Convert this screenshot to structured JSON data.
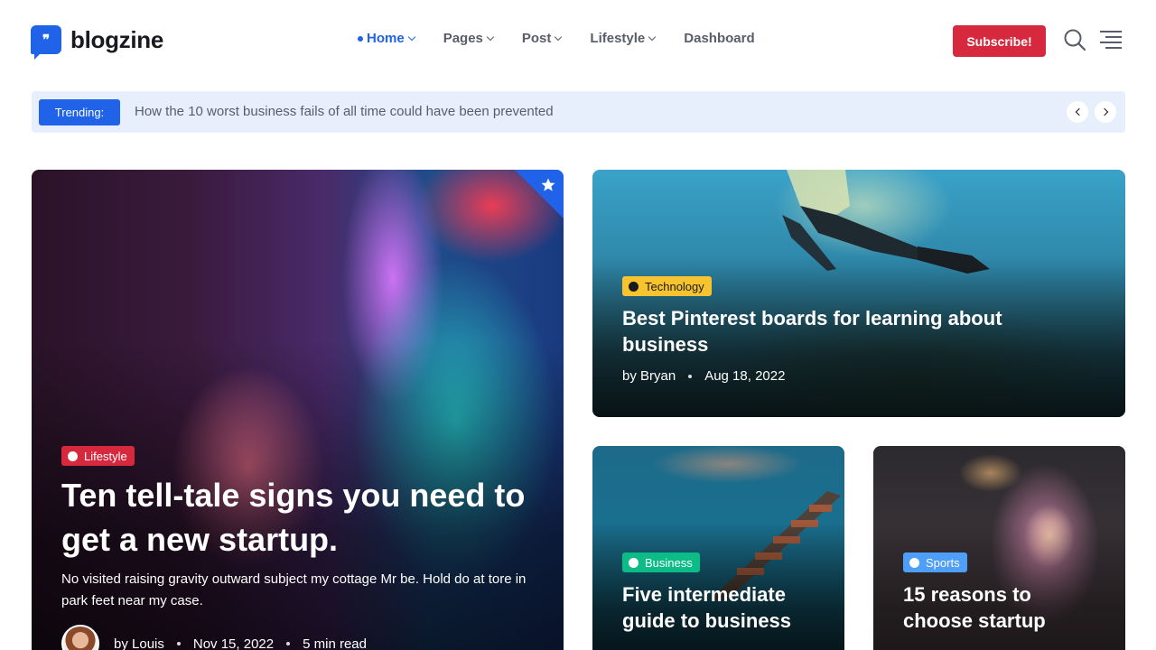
{
  "brand": {
    "name": "blogzine",
    "logo_glyph": "❞"
  },
  "nav": {
    "items": [
      {
        "label": "Home",
        "active": true,
        "dropdown": true
      },
      {
        "label": "Pages",
        "active": false,
        "dropdown": true
      },
      {
        "label": "Post",
        "active": false,
        "dropdown": true
      },
      {
        "label": "Lifestyle",
        "active": false,
        "dropdown": true
      },
      {
        "label": "Dashboard",
        "active": false,
        "dropdown": false
      }
    ]
  },
  "header": {
    "subscribe_label": "Subscribe!",
    "icons": [
      "search-icon",
      "menu-icon"
    ]
  },
  "trending": {
    "label": "Trending:",
    "headline": "How the 10 worst business fails of all time could have been prevented"
  },
  "featured": {
    "category": "Lifestyle",
    "title": "Ten tell-tale signs you need to get a new startup.",
    "description": "No visited raising gravity outward subject my cottage Mr be. Hold do at tore in park feet near my case.",
    "author": "by Louis",
    "date": "Nov 15, 2022",
    "read_time": "5 min read"
  },
  "top_card": {
    "category": "Technology",
    "title": "Best Pinterest boards for learning about business",
    "author": "by Bryan",
    "date": "Aug 18, 2022"
  },
  "bottom_left": {
    "category": "Business",
    "title": "Five intermediate guide to business"
  },
  "bottom_right": {
    "category": "Sports",
    "title": "15 reasons to choose startup"
  },
  "colors": {
    "primary": "#2163e8",
    "danger": "#d6293e",
    "warning": "#f7c32e",
    "success": "#0cbc87",
    "info": "#4f9ef8",
    "trending_bg": "#e7effd"
  }
}
